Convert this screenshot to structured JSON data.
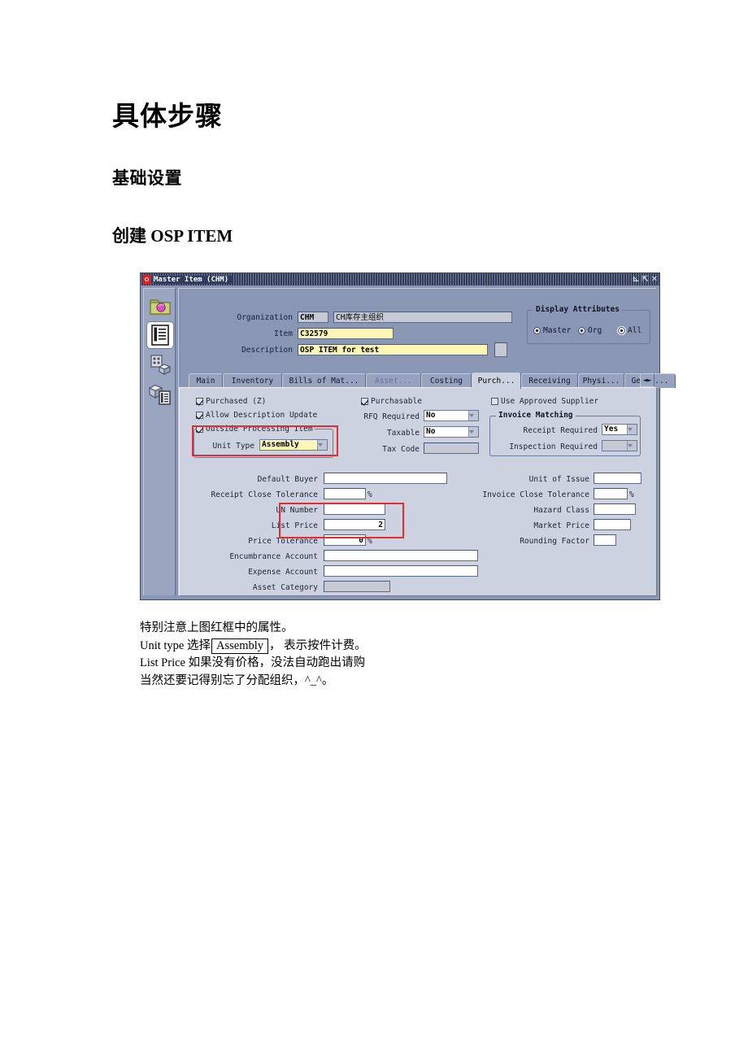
{
  "document": {
    "heading1": "具体步骤",
    "heading2": "基础设置",
    "heading3": "创建 OSP ITEM"
  },
  "window": {
    "title": "Master Item (CHM)",
    "controls": {
      "minimize": "⊾",
      "maximize": "⇱",
      "close": "✕"
    },
    "rail_icons": [
      "folder-icon",
      "list-document-icon",
      "building-box-icon",
      "box-list-icon"
    ]
  },
  "header": {
    "organization_label": "Organization",
    "organization_code": "CHM",
    "organization_desc": "CH库存主组织",
    "item_label": "Item",
    "item_value": "C32579",
    "description_label": "Description",
    "description_value": "OSP ITEM for test",
    "display_attributes": {
      "caption": "Display Attributes",
      "options": [
        {
          "label": "Master",
          "mnemonic": "M",
          "selected": false
        },
        {
          "label": "Org",
          "mnemonic": "O",
          "selected": false
        },
        {
          "label": "All",
          "mnemonic": "A",
          "selected": true
        }
      ]
    }
  },
  "tabs": [
    {
      "label": "Main",
      "active": false,
      "disabled": false
    },
    {
      "label": "Inventory",
      "active": false,
      "disabled": false
    },
    {
      "label": "Bills of Mat...",
      "active": false,
      "disabled": false
    },
    {
      "label": "Asset...",
      "active": false,
      "disabled": true
    },
    {
      "label": "Costing",
      "active": false,
      "disabled": false
    },
    {
      "label": "Purch...",
      "active": true,
      "disabled": false
    },
    {
      "label": "Receiving",
      "active": false,
      "disabled": false
    },
    {
      "label": "Physi...",
      "active": false,
      "disabled": false
    },
    {
      "label": "Gener...",
      "active": false,
      "disabled": false
    }
  ],
  "purchasing": {
    "checkboxes": {
      "purchased": {
        "label": "Purchased (Z)",
        "checked": true
      },
      "allow_description_update": {
        "label": "Allow Description Update",
        "checked": true
      },
      "outside_processing_item": {
        "label": "Outside Processing Item",
        "checked": true
      },
      "purchasable": {
        "label": "Purchasable",
        "checked": true
      },
      "use_approved_supplier": {
        "label": "Use Approved Supplier",
        "checked": false
      }
    },
    "unit_type": {
      "label": "Unit Type",
      "value": "Assembly"
    },
    "rfq_required": {
      "label": "RFQ Required",
      "value": "No"
    },
    "taxable": {
      "label": "Taxable",
      "value": "No"
    },
    "tax_code": {
      "label": "Tax Code",
      "value": ""
    },
    "invoice_matching": {
      "caption": "Invoice Matching",
      "receipt_required": {
        "label": "Receipt Required",
        "value": "Yes"
      },
      "inspection_required": {
        "label": "Inspection Required",
        "value": ""
      }
    },
    "fields_left": [
      {
        "label": "Default Buyer",
        "value": "",
        "suffix": ""
      },
      {
        "label": "Receipt Close Tolerance",
        "value": "",
        "suffix": "%"
      },
      {
        "label": "UN Number",
        "value": "",
        "suffix": ""
      },
      {
        "label": "List Price",
        "value": "2",
        "suffix": ""
      },
      {
        "label": "Price Tolerance",
        "value": "0",
        "suffix": "%"
      },
      {
        "label": "Encumbrance Account",
        "value": "",
        "suffix": ""
      },
      {
        "label": "Expense Account",
        "value": "",
        "suffix": ""
      },
      {
        "label": "Asset Category",
        "value": "",
        "suffix": ""
      }
    ],
    "fields_right": [
      {
        "label": "Unit of Issue",
        "value": "",
        "suffix": ""
      },
      {
        "label": "Invoice Close Tolerance",
        "value": "",
        "suffix": "%"
      },
      {
        "label": "Hazard Class",
        "value": "",
        "suffix": ""
      },
      {
        "label": "Market Price",
        "value": "",
        "suffix": ""
      },
      {
        "label": "Rounding Factor",
        "value": "",
        "suffix": ""
      }
    ]
  },
  "caption": {
    "line1": "特别注意上图红框中的属性。",
    "line2_a": "Unit type  选择",
    "line2_box": "Assembly",
    "line2_b": "，  表示按件计费。",
    "line3": "List Price  如果没有价格，没法自动跑出请购",
    "line4": "当然还要记得别忘了分配组织，^_^。"
  },
  "colors": {
    "annotation_red": "#ea2a2e",
    "window_chrome": "#8996b4",
    "panel": "#ccd2e0",
    "titlebar": "#2f3c5c",
    "field_yellow": "#fbf6b6"
  }
}
